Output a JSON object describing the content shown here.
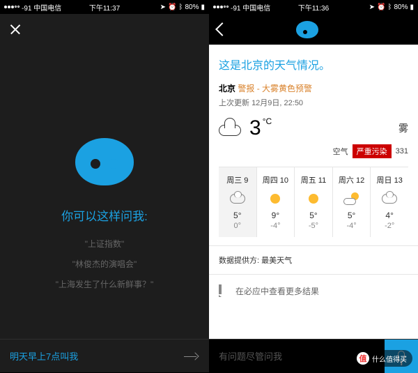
{
  "left": {
    "status": {
      "carrier": "-91 中国电信",
      "time": "下午11:37",
      "battery": "80%"
    },
    "prompt_title": "你可以这样问我:",
    "suggestions": [
      "\"上证指数\"",
      "\"林俊杰的演唱会\"",
      "\"上海发生了什么新鲜事？\""
    ],
    "input_text": "明天早上7点叫我"
  },
  "right": {
    "status": {
      "carrier": "-91 中国电信",
      "time": "下午11:36",
      "battery": "80%"
    },
    "title": "这是北京的天气情况。",
    "location": "北京",
    "alert": "警报 - 大雾黄色预警",
    "updated_label": "上次更新",
    "updated_time": "12月9日, 22:50",
    "current": {
      "temp": "3",
      "unit": "°C",
      "condition": "雾",
      "aq_label": "空气",
      "aq_badge": "严重污染",
      "aq_value": "331"
    },
    "forecast": [
      {
        "label": "周三 9",
        "icon": "cloudy",
        "hi": "5°",
        "lo": "0°"
      },
      {
        "label": "周四 10",
        "icon": "sun",
        "hi": "9°",
        "lo": "-4°"
      },
      {
        "label": "周五 11",
        "icon": "sun",
        "hi": "5°",
        "lo": "-5°"
      },
      {
        "label": "周六 12",
        "icon": "suncloud",
        "hi": "5°",
        "lo": "-4°"
      },
      {
        "label": "周日 13",
        "icon": "cloudy",
        "hi": "4°",
        "lo": "-2°"
      }
    ],
    "provider": "数据提供方: 最美天气",
    "bing_more": "在必应中查看更多结果",
    "input_placeholder": "有问题尽管问我"
  },
  "watermark": {
    "badge": "值",
    "text": "什么值得买"
  }
}
